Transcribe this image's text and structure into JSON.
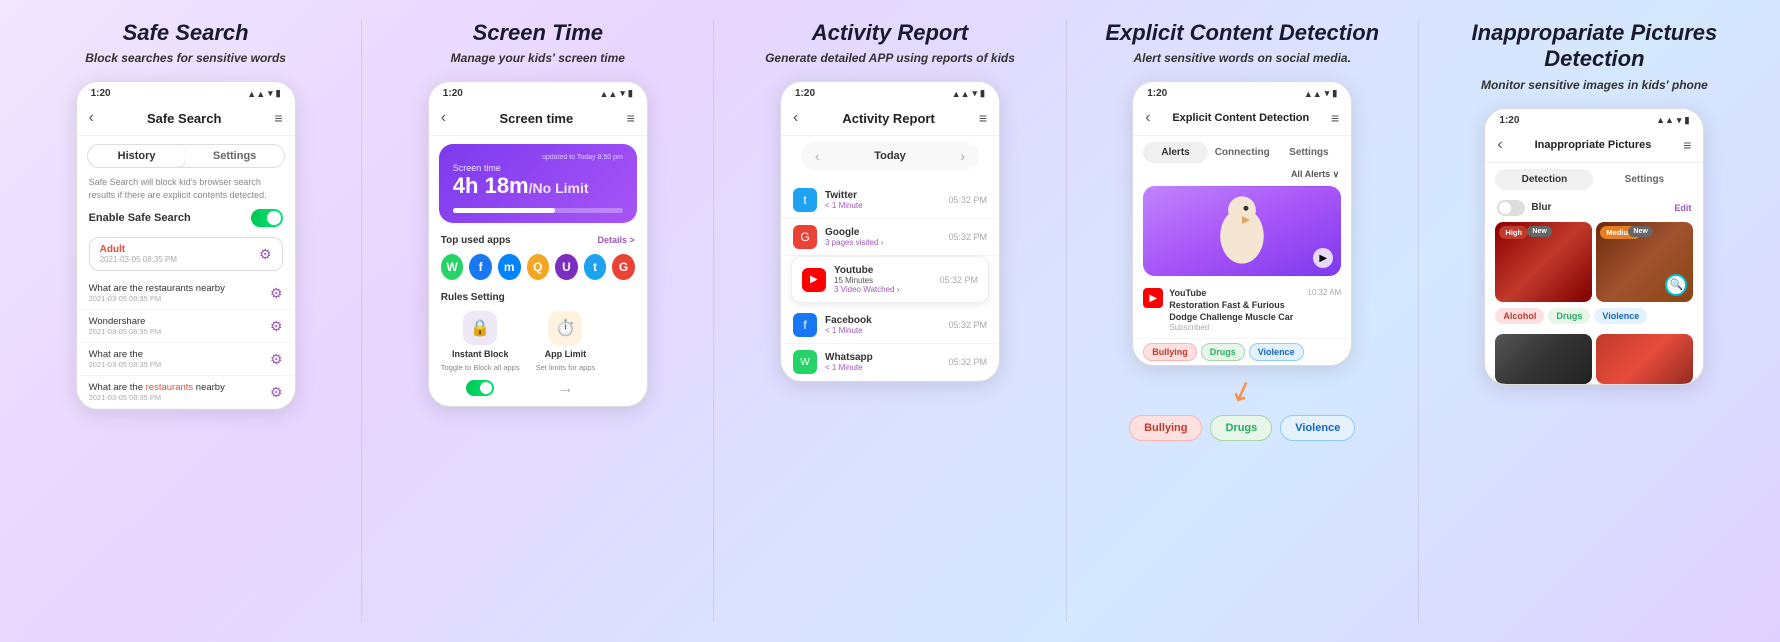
{
  "sections": [
    {
      "id": "safe-search",
      "title": "Safe Search",
      "subtitle": "Block searches for sensitive words",
      "phone": {
        "status_time": "1:20",
        "header_title": "Safe Search",
        "tabs": [
          "History",
          "Settings"
        ],
        "active_tab": "History",
        "desc": "Safe Search will block kid's browser search results if there are explicit contents detected.",
        "toggle_label": "Enable Safe Search",
        "toggle_on": true,
        "alert_item": {
          "label": "Adult",
          "date": "2021-03-05 08:35 PM"
        },
        "search_items": [
          {
            "text": "What are the restaurants nearby",
            "date": "2021-03-05 08:35 PM"
          },
          {
            "text": "Wondershare",
            "date": "2021-03-05 08:35 PM"
          },
          {
            "text": "What are the",
            "date": "2021-03-05 08:35 PM"
          },
          {
            "text": "What are the restaurants nearby",
            "date": "2021-03-05 08:35 PM",
            "highlight": "restaurants"
          }
        ]
      }
    },
    {
      "id": "screen-time",
      "title": "Screen Time",
      "subtitle": "Manage your kids' screen time",
      "phone": {
        "status_time": "1:20",
        "header_title": "Screen time",
        "card": {
          "label": "Screen time",
          "time": "4h 18m",
          "limit": "No Limit",
          "updated": "updated to Today 8:50 pm"
        },
        "top_apps_label": "Top used apps",
        "details_label": "Details >",
        "apps": [
          {
            "color": "#25D366",
            "letter": "W"
          },
          {
            "color": "#1877F2",
            "letter": "f"
          },
          {
            "color": "#0084FF",
            "letter": "m"
          },
          {
            "color": "#f5a623",
            "letter": "Q"
          },
          {
            "color": "#7B2FBE",
            "letter": "U"
          },
          {
            "color": "#1DA1F2",
            "letter": "t"
          },
          {
            "color": "#EA4335",
            "letter": "G"
          }
        ],
        "rules_title": "Rules Setting",
        "rules": [
          {
            "label": "Instant Block",
            "sublabel": "Toggle to Block all apps",
            "color": "#9b59b6",
            "emoji": "🔒"
          },
          {
            "label": "App Limit",
            "sublabel": "Set limits for apps",
            "color": "#ff8c42",
            "emoji": "⏱️"
          }
        ]
      }
    },
    {
      "id": "activity-report",
      "title": "Activity Report",
      "subtitle": "Generate detailed APP using reports of kids",
      "phone": {
        "status_time": "1:20",
        "header_title": "Activity Report",
        "nav_label": "Today",
        "items": [
          {
            "app": "Twitter",
            "color": "#1DA1F2",
            "letter": "t",
            "sub": "< 1 Minute",
            "time": "05:32 PM",
            "highlight": false
          },
          {
            "app": "Google",
            "color": "#EA4335",
            "letter": "G",
            "sub": "3 pages visited >",
            "time": "05:32 PM",
            "highlight": false
          },
          {
            "app": "Youtube",
            "color": "#FF0000",
            "letter": "▶",
            "sub": "15 Minutes",
            "sub2": "3 Video Watched >",
            "time": "05:32 PM",
            "highlight": true
          },
          {
            "app": "Facebook",
            "color": "#1877F2",
            "letter": "f",
            "sub": "< 1 Minute",
            "time": "05:32 PM",
            "highlight": false
          },
          {
            "app": "Whatsapp",
            "color": "#25D366",
            "letter": "W",
            "sub": "< 1 Minute",
            "time": "05:32 PM",
            "highlight": false
          }
        ]
      }
    },
    {
      "id": "explicit-content",
      "title": "Explicit Content Detection",
      "subtitle": "Alert sensitive words on social media.",
      "phone": {
        "status_time": "1:20",
        "header_title": "Explicit Content Detection",
        "tabs": [
          "Alerts",
          "Connecting",
          "Settings"
        ],
        "active_tab": "Alerts",
        "filter": "All Alerts ∨",
        "video": {
          "title": "YouTube",
          "time": "10:32 AM",
          "desc": "Restoration Fast & Furious Dodge Challenge Muscle Car",
          "sub": "Subscribed"
        },
        "tags": [
          "Bullying",
          "Drugs",
          "Violence"
        ]
      },
      "big_tags": [
        "Bullying",
        "Drugs",
        "Violence"
      ]
    },
    {
      "id": "inappropriate-pictures",
      "title": "Inappropariate Pictures Detection",
      "subtitle": "Monitor sensitive images in kids' phone",
      "phone": {
        "status_time": "1:20",
        "header_title": "Inappropriate Pictures",
        "tabs": [
          "Detection",
          "Settings"
        ],
        "active_tab": "Detection",
        "blur_label": "Blur",
        "edit_label": "Edit",
        "images": [
          {
            "badge": "High",
            "badge_color": "#c0392b",
            "new": true
          },
          {
            "badge": "Medium",
            "badge_color": "#e67e22",
            "new": true
          }
        ],
        "bottom_tags": [
          "Alcohol",
          "Drugs",
          "Violence"
        ]
      }
    }
  ],
  "colors": {
    "accent": "#9b59b6",
    "orange": "#ff8c42",
    "red": "#c0392b",
    "green": "#27ae60",
    "blue": "#1565c0"
  }
}
